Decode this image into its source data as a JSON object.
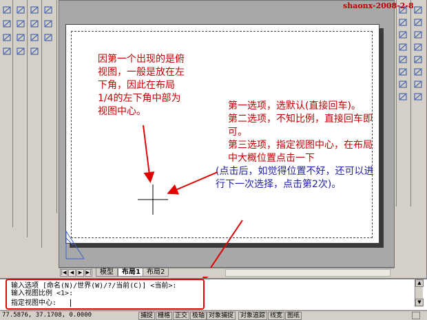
{
  "watermark": "shaonx-2008-2-8",
  "notes": {
    "left": "因第一个出现的是俯视图，一般是放在左下角，因此在布局1/4的左下角中部为视图中心。",
    "option1": "第一选项，选默认(直接回车)。",
    "option2": "第二选项，不知比例，直接回车即可。",
    "option3_red": "第三选项，指定视图中心，在布局中大概位置点击一下",
    "option3_blue": "(点击后，如觉得位置不好，还可以进行下一次选择，点击第2次)。"
  },
  "tabs": [
    {
      "label": "模型",
      "active": false
    },
    {
      "label": "布局1",
      "active": true
    },
    {
      "label": "布局2",
      "active": false
    }
  ],
  "command": {
    "lines": [
      "输入选项 [命名(N)/世界(W)/?/当前(C)] <当前>:",
      "输入视图比例 <1>:",
      "指定视图中心:"
    ]
  },
  "status": {
    "coords": "77.5876,  37.1708, 0.0000",
    "buttons": [
      "捕捉",
      "栅格",
      "正交",
      "极轴",
      "对象捕捉",
      "对象追踪",
      "线宽",
      "图纸"
    ]
  },
  "colors": {
    "note_red": "#c00000",
    "note_blue": "#2020b0",
    "annotation_red": "#e00000"
  },
  "toolbar": {
    "left_icons": [
      "line-icon",
      "xline-icon",
      "polyline-icon",
      "polygon-icon",
      "rectangle-icon",
      "arc-icon",
      "circle-icon",
      "spline-icon",
      "ellipse-icon",
      "insert-block-icon",
      "point-icon",
      "hatch-icon",
      "region-icon",
      "table-icon",
      "text-icon"
    ],
    "right_icons": [
      "erase-icon",
      "copy-icon",
      "mirror-icon",
      "offset-icon",
      "array-icon",
      "move-icon",
      "rotate-icon",
      "scale-icon",
      "stretch-icon",
      "trim-icon",
      "extend-icon",
      "break-icon",
      "chamfer-icon",
      "fillet-icon",
      "explode-icon",
      "text-A-icon"
    ]
  }
}
